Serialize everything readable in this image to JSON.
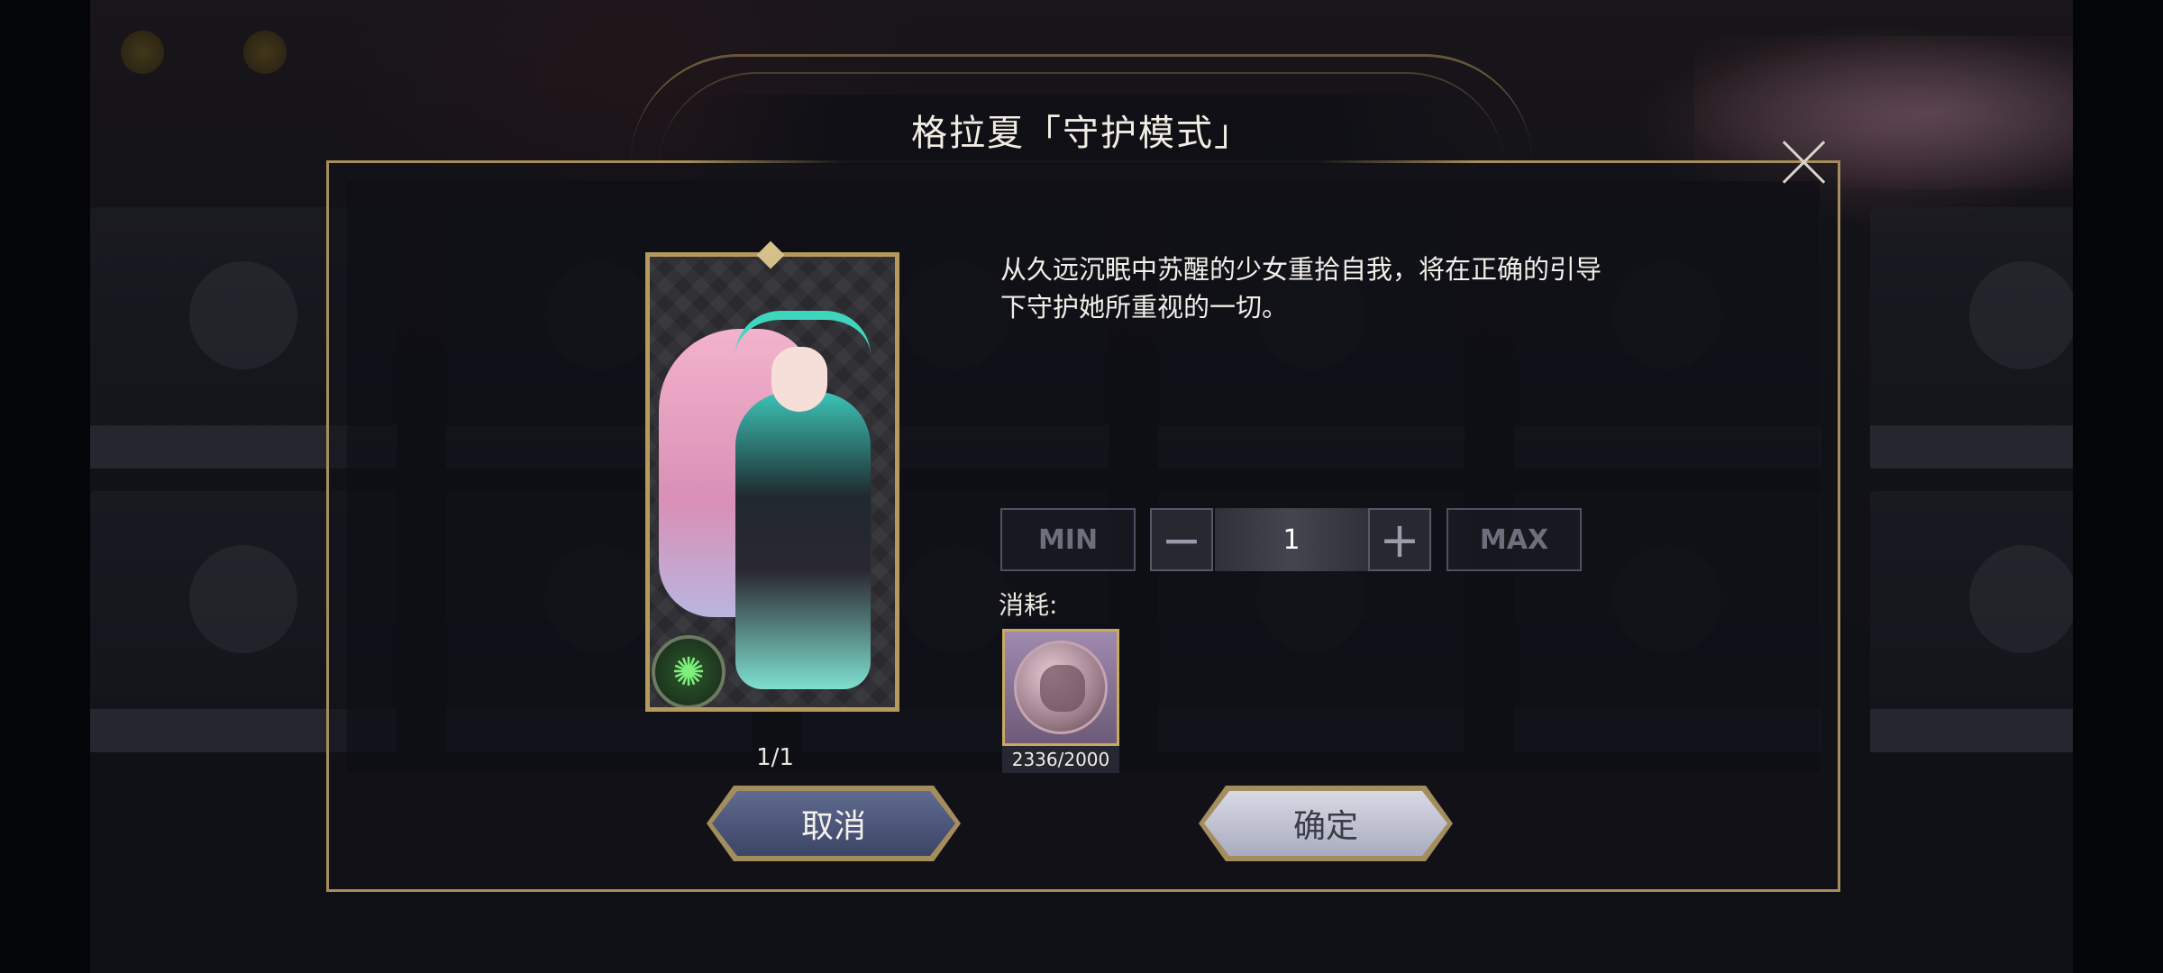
{
  "dialog": {
    "title": "格拉夏「守护模式」",
    "description": "从久远沉眠中苏醒的少女重拾自我，将在正确的引导下守护她所重视的一切。",
    "card_count": "1/1"
  },
  "quantity": {
    "min_label": "MIN",
    "max_label": "MAX",
    "minus_symbol": "−",
    "plus_symbol": "+",
    "value": "1"
  },
  "cost": {
    "label": "消耗:",
    "count": "2336/2000"
  },
  "buttons": {
    "cancel": "取消",
    "confirm": "确定"
  },
  "icons": {
    "close": "close-icon",
    "emblem": "wind-element-icon",
    "cost_item": "medal-coin-icon"
  },
  "colors": {
    "frame_gold": "#a68e5c",
    "cancel_button": "#4d5679",
    "confirm_button": "#c4c6d4"
  }
}
